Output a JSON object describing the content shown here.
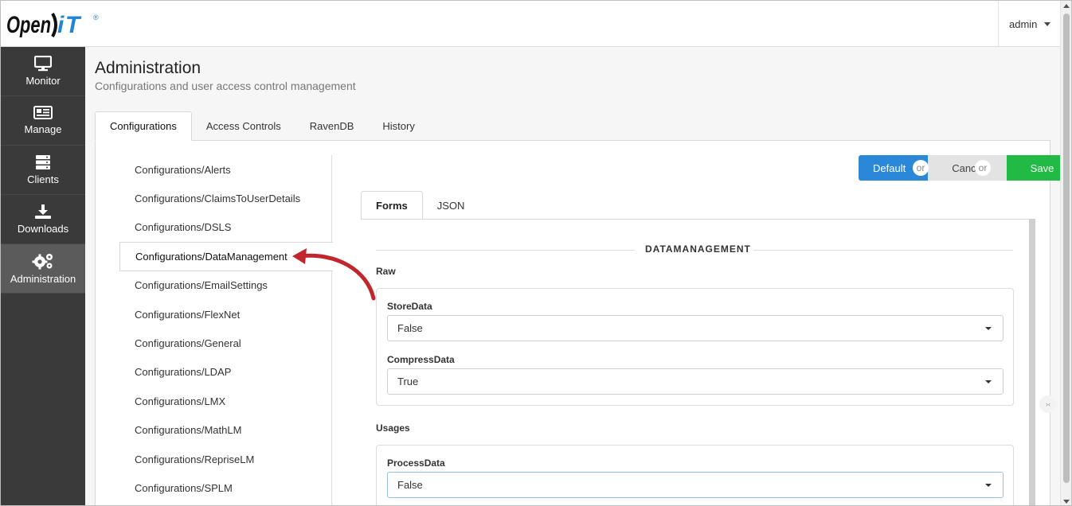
{
  "brand": {
    "logo_text": "OpenIT"
  },
  "header": {
    "user": "admin"
  },
  "sidebar": {
    "items": [
      {
        "label": "Monitor",
        "icon": "monitor-icon"
      },
      {
        "label": "Manage",
        "icon": "newspaper-icon"
      },
      {
        "label": "Clients",
        "icon": "server-icon"
      },
      {
        "label": "Downloads",
        "icon": "download-icon"
      },
      {
        "label": "Administration",
        "icon": "cogs-icon",
        "active": true
      }
    ]
  },
  "page": {
    "title": "Administration",
    "subtitle": "Configurations and user access control management"
  },
  "tabs": [
    "Configurations",
    "Access Controls",
    "RavenDB",
    "History"
  ],
  "configurations": [
    "Configurations/Alerts",
    "Configurations/ClaimsToUserDetails",
    "Configurations/DSLS",
    "Configurations/DataManagement",
    "Configurations/EmailSettings",
    "Configurations/FlexNet",
    "Configurations/General",
    "Configurations/LDAP",
    "Configurations/LMX",
    "Configurations/MathLM",
    "Configurations/RepriseLM",
    "Configurations/SPLM"
  ],
  "actions": {
    "default": "Default",
    "cancel": "Cancel",
    "save": "Save",
    "or": "or"
  },
  "inner_tabs": [
    "Forms",
    "JSON"
  ],
  "form": {
    "section": "DATAMANAGEMENT",
    "raw": {
      "label": "Raw",
      "store_data": {
        "label": "StoreData",
        "value": "False"
      },
      "compress_data": {
        "label": "CompressData",
        "value": "True"
      }
    },
    "usages": {
      "label": "Usages",
      "process_data": {
        "label": "ProcessData",
        "value": "False"
      }
    }
  },
  "colors": {
    "accent": "#2b88d8",
    "save": "#21ba45",
    "sidebar": "#3a3a3a",
    "arrow": "#c0272d"
  }
}
